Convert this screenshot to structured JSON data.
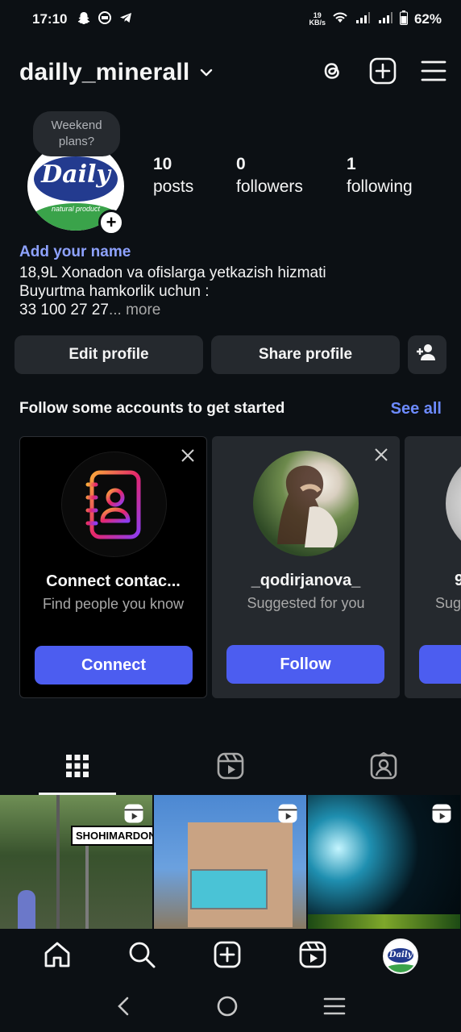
{
  "status_bar": {
    "time": "17:10",
    "speed_value": "19",
    "speed_unit": "KB/s",
    "battery": "62%"
  },
  "header": {
    "username": "dailly_minerall"
  },
  "profile": {
    "note": "Weekend plans?",
    "avatar_brand": "Daily",
    "avatar_subtext": "natural product",
    "stats": [
      {
        "value": "10",
        "label": "posts"
      },
      {
        "value": "0",
        "label": "followers"
      },
      {
        "value": "1",
        "label": "following"
      }
    ],
    "add_name": "Add your name",
    "bio_line1": "18,9L Xonadon va ofislarga yetkazish hizmati",
    "bio_line2": "Buyurtma hamkorlik uchun :",
    "bio_line3": "33 100 27 27",
    "bio_more": "... more"
  },
  "buttons": {
    "edit": "Edit profile",
    "share": "Share profile"
  },
  "suggestions": {
    "title": "Follow some accounts to get started",
    "see_all": "See all",
    "cards": [
      {
        "name": "Connect contac...",
        "sub": "Find people you know",
        "cta": "Connect"
      },
      {
        "name": "_qodirjanova_",
        "sub": "Suggested for you",
        "cta": "Follow"
      },
      {
        "name": "9",
        "sub": "Sug",
        "cta": ""
      }
    ]
  },
  "grid": {
    "cell1_sign": "SHOHIMARDON"
  },
  "colors": {
    "background": "#0c1014",
    "button": "#25292e",
    "accent_blue": "#4c5df0",
    "link_blue": "#6d8bff",
    "name_link": "#8ea2ff"
  }
}
